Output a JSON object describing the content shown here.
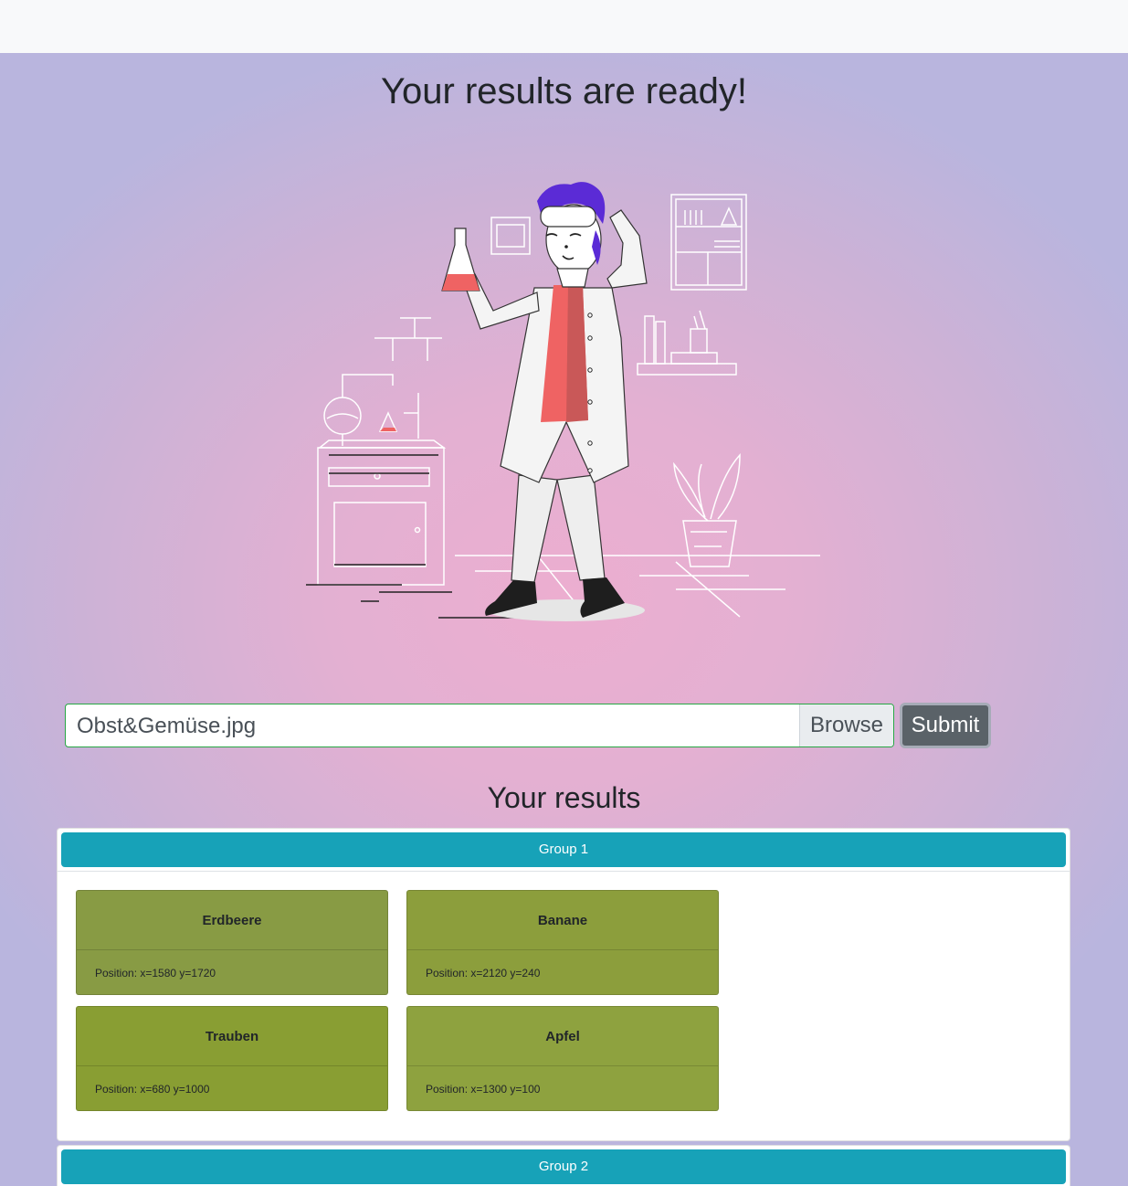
{
  "hero": {
    "title": "Your results are ready!"
  },
  "upload": {
    "file_name": "Obst&Gemüse.jpg",
    "browse_label": "Browse",
    "submit_label": "Submit"
  },
  "results": {
    "title": "Your results",
    "groups": [
      {
        "label": "Group 1",
        "items": [
          {
            "name": "Erdbeere",
            "position": "Position: x=1580 y=1720",
            "color": "#889b44"
          },
          {
            "name": "Banane",
            "position": "Position: x=2120 y=240",
            "color": "#8c9e3c"
          },
          {
            "name": "Trauben",
            "position": "Position: x=680 y=1000",
            "color": "#899e33"
          },
          {
            "name": "Apfel",
            "position": "Position: x=1300 y=100",
            "color": "#8ea23f"
          }
        ]
      },
      {
        "label": "Group 2",
        "items": []
      }
    ]
  },
  "colors": {
    "group_header": "#17a2b8",
    "submit_button": "#5a6268",
    "file_field_border": "#28a745",
    "hair": "#5b2bd6",
    "shirt": "#ef6363"
  },
  "icons": {
    "illustration": "scientist-lab-illustration"
  }
}
